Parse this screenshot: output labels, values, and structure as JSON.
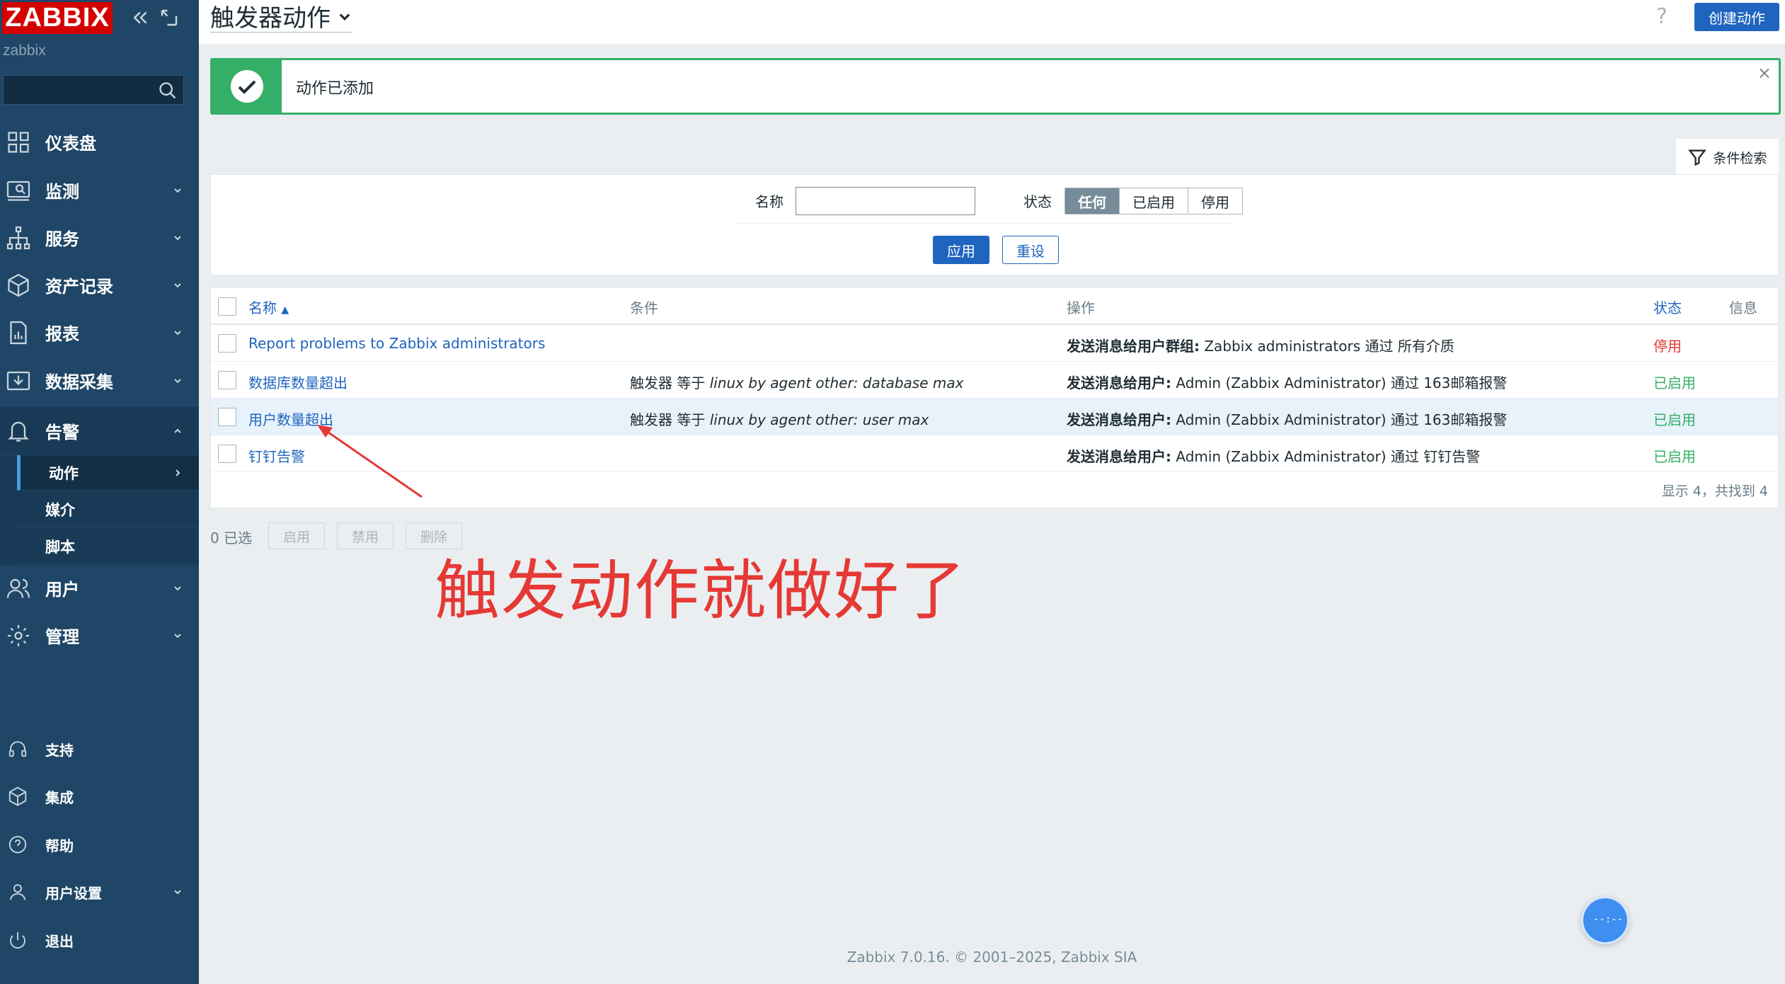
{
  "sidebar": {
    "logo": "ZABBIX",
    "server_name": "zabbix",
    "search_placeholder": "",
    "menu": [
      {
        "label": "仪表盘",
        "icon": "dashboard-icon"
      },
      {
        "label": "监测",
        "icon": "monitoring-icon"
      },
      {
        "label": "服务",
        "icon": "services-icon"
      },
      {
        "label": "资产记录",
        "icon": "inventory-icon"
      },
      {
        "label": "报表",
        "icon": "reports-icon"
      },
      {
        "label": "数据采集",
        "icon": "data-collection-icon"
      },
      {
        "label": "告警",
        "icon": "alerts-bell-icon"
      },
      {
        "label": "用户",
        "icon": "users-icon"
      },
      {
        "label": "管理",
        "icon": "administration-gear-icon"
      }
    ],
    "alerts_submenu": [
      "动作",
      "媒介",
      "脚本"
    ],
    "bottom": [
      {
        "label": "支持",
        "icon": "support-headset-icon"
      },
      {
        "label": "集成",
        "icon": "integrations-box-icon"
      },
      {
        "label": "帮助",
        "icon": "help-circle-icon"
      },
      {
        "label": "用户设置",
        "icon": "user-settings-icon"
      },
      {
        "label": "退出",
        "icon": "power-icon"
      }
    ]
  },
  "header": {
    "title": "触发器动作",
    "help": "?",
    "create_button": "创建动作"
  },
  "message": {
    "text": "动作已添加",
    "close": "×"
  },
  "filter": {
    "tab_label": "条件检索",
    "name_label": "名称",
    "name_value": "",
    "status_label": "状态",
    "status_options": [
      "任何",
      "已启用",
      "停用"
    ],
    "status_selected": "任何",
    "apply": "应用",
    "reset": "重设"
  },
  "table": {
    "headers": {
      "name": "名称",
      "name_sort": "▲",
      "conditions": "条件",
      "operations": "操作",
      "status": "状态",
      "info": "信息"
    },
    "rows": [
      {
        "name": "Report problems to Zabbix administrators",
        "cond_prefix": "",
        "cond_italic": "",
        "op_bold": "发送消息给用户群组:",
        "op_text": " Zabbix administrators 通过 所有介质",
        "status": "停用"
      },
      {
        "name": "数据库数量超出",
        "cond_prefix": "触发器 等于 ",
        "cond_italic": "linux by agent other: database max",
        "op_bold": "发送消息给用户:",
        "op_text": " Admin (Zabbix Administrator) 通过 163邮箱报警",
        "status": "已启用"
      },
      {
        "name": "用户数量超出",
        "cond_prefix": "触发器 等于 ",
        "cond_italic": "linux by agent other: user max",
        "op_bold": "发送消息给用户:",
        "op_text": " Admin (Zabbix Administrator) 通过 163邮箱报警",
        "status": "已启用"
      },
      {
        "name": "钉钉告警",
        "cond_prefix": "",
        "cond_italic": "",
        "op_bold": "发送消息给用户:",
        "op_text": " Admin (Zabbix Administrator) 通过 钉钉告警",
        "status": "已启用"
      }
    ],
    "footer": "显示 4，共找到 4"
  },
  "mass_actions": {
    "selected": "0 已选",
    "enable": "启用",
    "disable": "禁用",
    "delete": "删除"
  },
  "annotation": "触发动作就做好了",
  "footer": "Zabbix 7.0.16. © 2001–2025, Zabbix SIA",
  "widget_text": "--:--",
  "colors": {
    "sidebar": "#1f4666",
    "brand_red": "#d40000",
    "primary_blue": "#1f65bf",
    "success_green": "#34af67",
    "disabled_red": "#e33734",
    "annotation_red": "#e53935"
  }
}
